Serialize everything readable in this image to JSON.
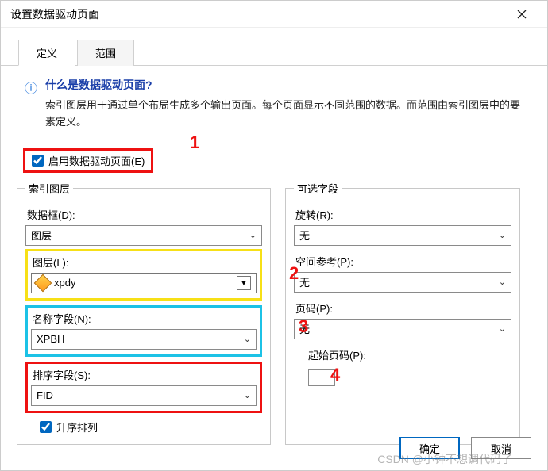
{
  "window": {
    "title": "设置数据驱动页面"
  },
  "tabs": {
    "definition": "定义",
    "scope": "范围"
  },
  "help": {
    "title": "什么是数据驱动页面?",
    "body": "索引图层用于通过单个布局生成多个输出页面。每个页面显示不同范围的数据。而范围由索引图层中的要素定义。"
  },
  "enable": {
    "label": "启用数据驱动页面(E)"
  },
  "left": {
    "legend": "索引图层",
    "dataframe_label": "数据框(D):",
    "dataframe_value": "图层",
    "layer_label": "图层(L):",
    "layer_value": "xpdy",
    "name_label": "名称字段(N):",
    "name_value": "XPBH",
    "sort_label": "排序字段(S):",
    "sort_value": "FID",
    "asc_label": "升序排列"
  },
  "right": {
    "legend": "可选字段",
    "rotation_label": "旋转(R):",
    "rotation_value": "无",
    "sref_label": "空间参考(P):",
    "sref_value": "无",
    "page_label": "页码(P):",
    "page_value": "无",
    "start_label": "起始页码(P):"
  },
  "annotations": {
    "a1": "1",
    "a2": "2",
    "a3": "3",
    "a4": "4"
  },
  "buttons": {
    "ok": "确定",
    "cancel": "取消"
  },
  "watermark": "CSDN @小钟不想调代码了"
}
